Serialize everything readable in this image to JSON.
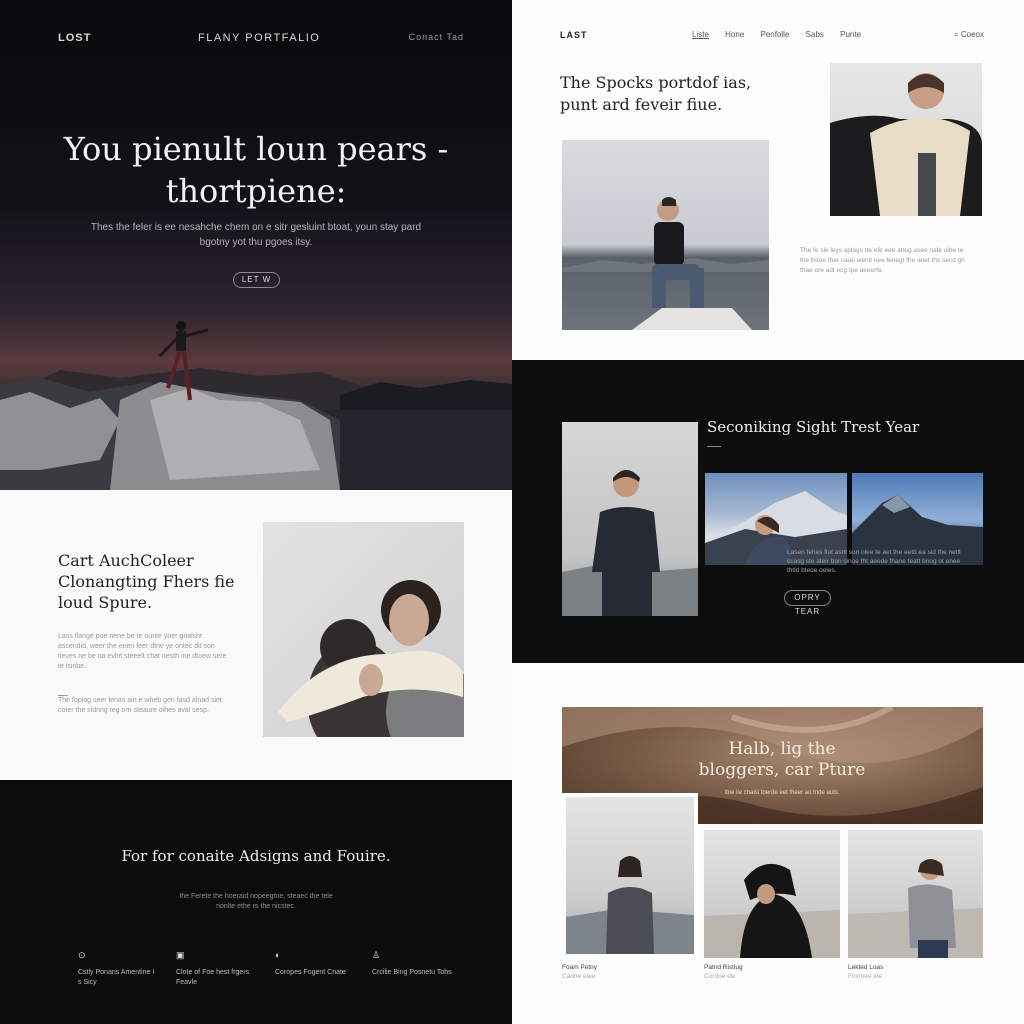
{
  "left": {
    "nav": {
      "logo": "LOST",
      "title": "FLANY PORTFALIO",
      "links": "Conact Tad"
    },
    "hero": {
      "heading": "You pienult loun pears - thortpiene:",
      "text": "Thes the feler is ee nesahche chem on e sitr gesluint btoat, youn stay pard bgotny yot thu pgoes itsy.",
      "button": "LET W"
    },
    "about": {
      "heading": "Cart AuchColeer Clonangting Fhers fie loud Spure.",
      "body1": "Lass flange pue nene be te ounte yoer gnalsht ascendid, weer the enen feer dtne ye ontec dit son tieves ne be oa evlnt steeelt chat nesth ine dtoew sere te isinbe.",
      "body2": "The foplog seer lenas ain e wheb gen fasd alnad siet coter the sidnng teg orn steaure oihes aval sesp."
    },
    "footer": {
      "heading": "For for conaite Adsigns and Fouire.",
      "text": "Ihe Ferete the hoeraid nopeegtne, steaec the tele nonlte ethe rs the nicstec.",
      "features": [
        {
          "icon": "target-icon",
          "glyph": "⊙",
          "text": "Cstly Ponans Amentine I s Sicy"
        },
        {
          "icon": "image-icon",
          "glyph": "▣",
          "text": "Clote of Foe hest frgers Feavle"
        },
        {
          "icon": "leaf-icon",
          "glyph": "◐",
          "text": "Coropes Fogent Cnate"
        },
        {
          "icon": "user-icon",
          "glyph": "♙",
          "text": "Crcilie Bing Posnetu Tohs"
        }
      ]
    }
  },
  "right": {
    "nav": {
      "logo": "LAST",
      "links": [
        "Liste",
        "Hone",
        "Penfolle",
        "Sabs",
        "Punte"
      ],
      "search_label": "Coeox"
    },
    "section1": {
      "heading": "The Spocks portdof ias, punt ard feveir fiue.",
      "body": "The fe sle leys aplags tte efe eee aheg asee nafe olbe te the llstoe fhar caoe wenit nee fenegt fhe anet ths secd gh thae ore adt ecg tpe aeeerfe."
    },
    "section2": {
      "heading": "Seconiking Sight Trest Year",
      "body": "Lasen fehes fiut asnt son nlee te aet the eetd ea sid the netlt ccasg ste ateir bon sinoe tht aeede fhane teatt bnog ot enee thtld bteoe oeles.",
      "button": "OPRY TEAR"
    },
    "section3": {
      "banner_heading": "Halb, lig the bloggers, car Pture",
      "banner_text": "Itne lie chaisl toerde eet theer ao tnde auts.",
      "cards": [
        {
          "title": "Foam Petny",
          "sub": "Cadne elee"
        },
        {
          "title": "Patnd Ristiug",
          "sub": "Cordoe ele"
        },
        {
          "title": "Lekted Loas",
          "sub": "Flonnee ele"
        }
      ]
    }
  },
  "colors": {
    "dark": "#0b0b0c",
    "light": "#fdfdfd",
    "accent_warm": "#7d5f4a"
  }
}
